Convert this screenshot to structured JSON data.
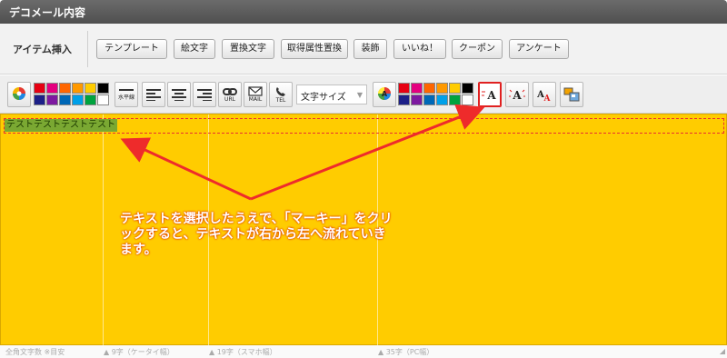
{
  "title": "デコメール内容",
  "items": {
    "label": "アイテム挿入",
    "buttons": [
      "テンプレート",
      "絵文字",
      "置換文字",
      "取得属性置換",
      "装飾",
      "いいね！",
      "クーポン",
      "アンケート"
    ]
  },
  "toolbar": {
    "hr_label": "水平線",
    "url_label": "URL",
    "mail_label": "MAIL",
    "tel_label": "TEL",
    "font_size_label": "文字サイズ",
    "palette_colors": [
      "#e60012",
      "#e4007f",
      "#ff6600",
      "#ff9900",
      "#ffcc00",
      "#000000",
      "#1d2088",
      "#7d1aa0",
      "#0068b7",
      "#00a0e9",
      "#00a33e",
      "#ffffff"
    ]
  },
  "editor": {
    "selected_text": "テストテストテストテスト",
    "annotation": "テキストを選択したうえで、「マーキー」をクリックすると、テキストが右から左へ流れていきます。",
    "background": "#ffcc00"
  },
  "footer": {
    "note": "全角文字数 ※目安",
    "g1": "▲ 9字（ケータイ幅）",
    "g2": "▲ 19字（スマホ幅）",
    "g3": "▲ 35字（PC幅）"
  }
}
